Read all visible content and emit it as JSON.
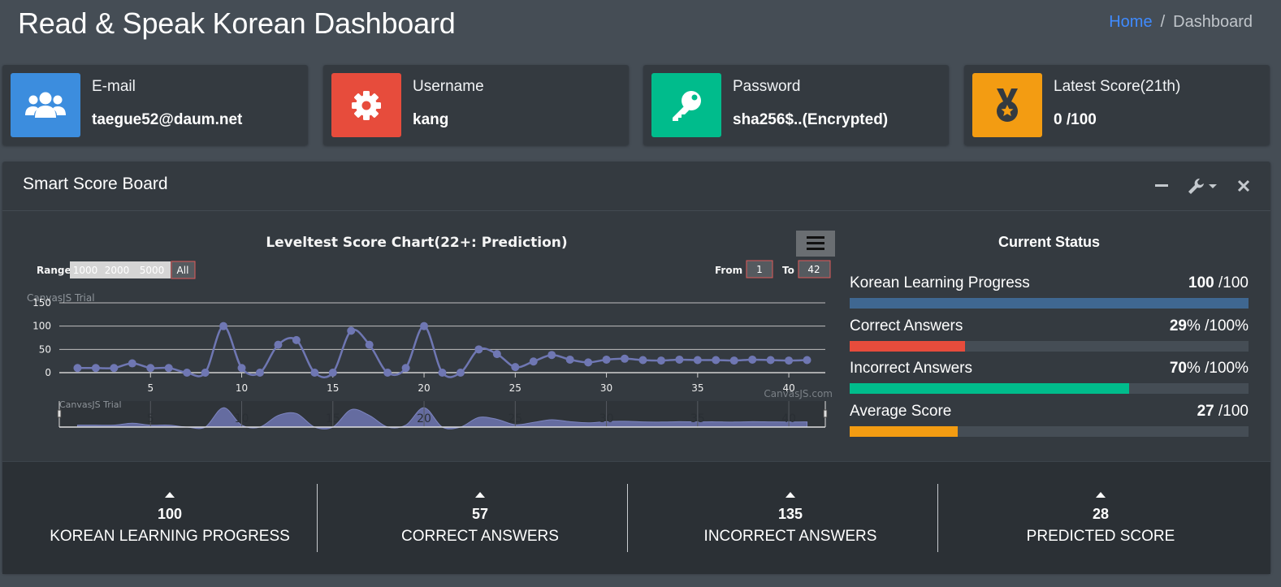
{
  "header": {
    "title": "Read & Speak Korean Dashboard"
  },
  "breadcrumb": {
    "home": "Home",
    "separator": "/",
    "current": "Dashboard"
  },
  "info_boxes": [
    {
      "label": "E-mail",
      "value": "taegue52@daum.net",
      "icon": "users-icon",
      "color": "#3c8dde"
    },
    {
      "label": "Username",
      "value": "kang",
      "icon": "gear-icon",
      "color": "#e74c3c"
    },
    {
      "label": "Password",
      "value": "sha256$..(Encrypted)",
      "icon": "key-icon",
      "color": "#00bc8c"
    },
    {
      "label": "Latest Score(21th)",
      "value": "0 /100",
      "icon": "medal-icon",
      "color": "#f39c12"
    }
  ],
  "scoreboard": {
    "title": "Smart Score Board",
    "tools": [
      "minus-icon",
      "wrench-icon",
      "close-icon"
    ]
  },
  "chart": {
    "title": "Leveltest Score Chart(22+: Prediction)",
    "range_label": "Range",
    "range_buttons": [
      "1000",
      "2000",
      "5000",
      "All"
    ],
    "selected_range": "All",
    "from_label": "From",
    "from_value": "1",
    "to_label": "To",
    "to_value": "42",
    "watermark_trial": "CanvasJS Trial",
    "watermark_site": "CanvasJS.com",
    "menu_icon": "hamburger-menu-icon"
  },
  "chart_data": {
    "type": "line",
    "title": "Leveltest Score Chart(22+: Prediction)",
    "xlabel": "",
    "ylabel": "",
    "xlim": [
      0,
      42
    ],
    "ylim": [
      0,
      150
    ],
    "x_ticks": [
      5,
      10,
      15,
      20,
      25,
      30,
      35,
      40
    ],
    "y_ticks": [
      0,
      50,
      100,
      150
    ],
    "grid": true,
    "series": [
      {
        "color": "#6f77b3",
        "x": [
          1,
          2,
          3,
          4,
          5,
          6,
          7,
          8,
          9,
          10,
          11,
          12,
          13,
          14,
          15,
          16,
          17,
          18,
          19,
          20,
          21,
          22,
          23,
          24,
          25,
          26,
          27,
          28,
          29,
          30,
          31,
          32,
          33,
          34,
          35,
          36,
          37,
          38,
          39,
          40,
          41
        ],
        "values": [
          10,
          10,
          10,
          20,
          10,
          10,
          0,
          0,
          100,
          10,
          0,
          60,
          70,
          0,
          0,
          90,
          60,
          0,
          10,
          100,
          0,
          0,
          50,
          40,
          12,
          24,
          38,
          28,
          22,
          28,
          30,
          27,
          26,
          28,
          27,
          27,
          26,
          28,
          27,
          26,
          27
        ]
      }
    ]
  },
  "status": {
    "title": "Current Status",
    "items": [
      {
        "label": "Korean Learning Progress",
        "value": "100",
        "suffix": " /100",
        "fraction": 1.0,
        "color": "#3f6791"
      },
      {
        "label": "Correct Answers",
        "value": "29",
        "suffix": "% /100%",
        "fraction": 0.29,
        "color": "#e74c3c"
      },
      {
        "label": "Incorrect Answers",
        "value": "70",
        "suffix": "% /100%",
        "fraction": 0.7,
        "color": "#00bc8c"
      },
      {
        "label": "Average Score",
        "value": "27",
        "suffix": " /100",
        "fraction": 0.27,
        "color": "#f39c12"
      }
    ]
  },
  "footer_stats": [
    {
      "value": "100",
      "label": "KOREAN LEARNING PROGRESS",
      "icon": "caret-up-icon"
    },
    {
      "value": "57",
      "label": "CORRECT ANSWERS",
      "icon": "caret-up-icon"
    },
    {
      "value": "135",
      "label": "INCORRECT ANSWERS",
      "icon": "caret-up-icon"
    },
    {
      "value": "28",
      "label": "PREDICTED SCORE",
      "icon": "caret-up-icon"
    }
  ]
}
